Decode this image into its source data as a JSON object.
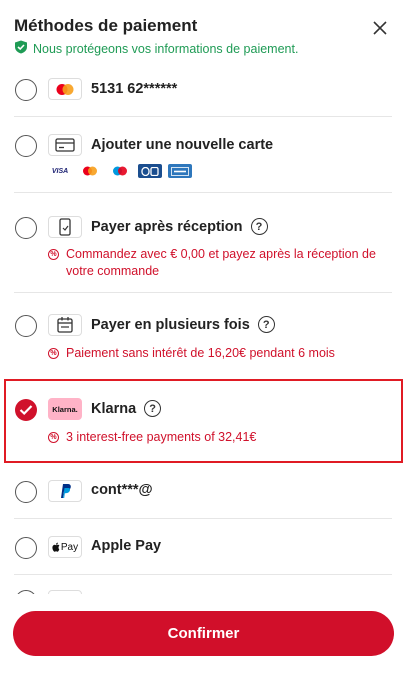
{
  "header": {
    "title": "Méthodes de paiement",
    "protect_text": "Nous protégeons vos informations de paiement."
  },
  "options": [
    {
      "label": "5131 62******",
      "icon": "mastercard-icon",
      "selected": false
    },
    {
      "label": "Ajouter une nouvelle carte",
      "icon": "credit-card-icon",
      "selected": false,
      "brands": [
        "VISA",
        "MC",
        "MAESTRO",
        "CB",
        "AMEX"
      ]
    },
    {
      "label": "Payer après réception",
      "icon": "delivery-pay-icon",
      "selected": false,
      "note": "Commandez avec € 0,00 et payez après la réception de votre commande"
    },
    {
      "label": "Payer en plusieurs fois",
      "icon": "calendar-icon",
      "selected": false,
      "note": "Paiement sans intérêt de 16,20€ pendant 6 mois"
    },
    {
      "label": "Klarna",
      "icon": "klarna-logo",
      "icon_text": "Klarna.",
      "selected": true,
      "note": "3 interest-free payments of 32,41€"
    },
    {
      "label": "cont***@",
      "icon": "paypal-icon",
      "selected": false
    },
    {
      "label": "Apple Pay",
      "icon": "apple-pay-icon",
      "icon_text": "Pay",
      "selected": false
    }
  ],
  "confirm_label": "Confirmer",
  "colors": {
    "accent": "#d10f2a",
    "success": "#1f9b55",
    "klarna_pink": "#ffb3c7"
  }
}
